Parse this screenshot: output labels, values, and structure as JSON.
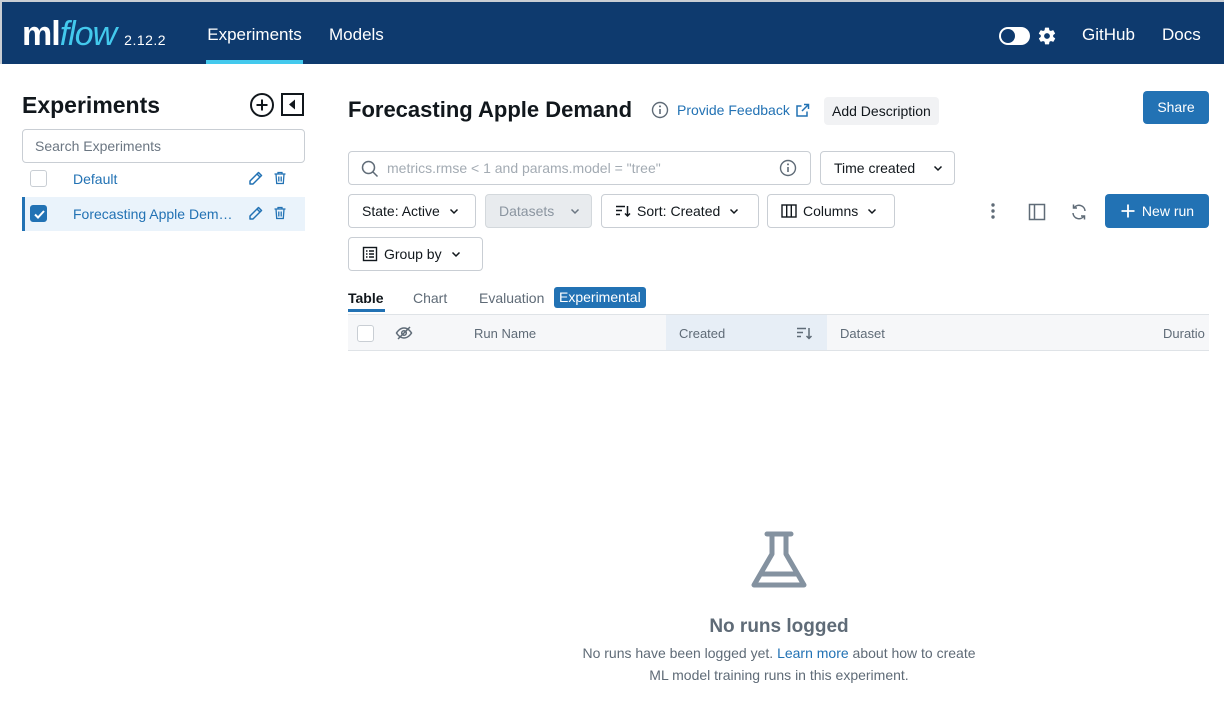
{
  "header": {
    "logo_ml": "ml",
    "logo_flow": "flow",
    "version": "2.12.2",
    "nav": [
      "Experiments",
      "Models"
    ],
    "links": [
      "GitHub",
      "Docs"
    ],
    "colors": {
      "bar": "#0e3a6e",
      "accent": "#43c9ed"
    },
    "icons": [
      "theme-toggle-icon",
      "gear-icon"
    ]
  },
  "sidebar": {
    "title": "Experiments",
    "search_placeholder": "Search Experiments",
    "experiments": [
      {
        "name": "Default",
        "checked": false
      },
      {
        "name": "Forecasting Apple Demand",
        "checked": true
      }
    ]
  },
  "main": {
    "title": "Forecasting Apple Demand",
    "feedback_label": "Provide Feedback",
    "add_description_label": "Add Description",
    "share_label": "Share",
    "search_placeholder": "metrics.rmse < 1 and params.model = \"tree\"",
    "time_created_label": "Time created",
    "state_label": "State: Active",
    "datasets_label": "Datasets",
    "sort_label": "Sort: Created",
    "columns_label": "Columns",
    "group_by_label": "Group by",
    "new_run_label": "New run",
    "tabs": [
      "Table",
      "Chart",
      "Evaluation"
    ],
    "experimental_badge": "Experimental",
    "table_columns": [
      "Run Name",
      "Created",
      "Dataset",
      "Duratio"
    ],
    "empty": {
      "title": "No runs logged",
      "text_before": "No runs have been logged yet.",
      "link": "Learn more",
      "text_after": "about how to create ML model training runs in this experiment."
    },
    "colors": {
      "primary": "#2272b4"
    }
  }
}
